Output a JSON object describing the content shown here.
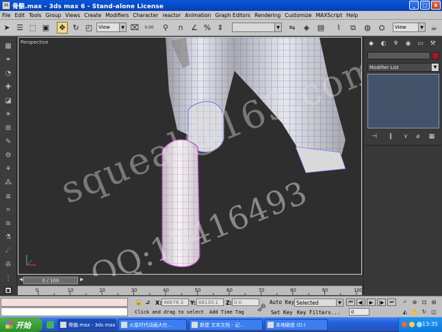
{
  "window": {
    "title": "骨骼.max - 3ds max 6 - Stand-alone License",
    "app_icon": "3ds-max-icon",
    "buttons": {
      "minimize": "_",
      "maximize": "□",
      "close": "x"
    }
  },
  "menubar": {
    "items": [
      "File",
      "Edit",
      "Tools",
      "Group",
      "Views",
      "Create",
      "Modifiers",
      "Character",
      "reactor",
      "Animation",
      "Graph Editors",
      "Rendering",
      "Customize",
      "MAXScript",
      "Help"
    ]
  },
  "toolbar": {
    "icons": [
      "select-arrow-icon",
      "select-by-name-icon",
      "rect-selection-icon",
      "window-crossing-icon",
      "move-icon",
      "rotate-icon",
      "scale-icon",
      "view-combo",
      "pivot-icon",
      "select-manipulate-icon",
      "snap-2d-icon",
      "angle-snap-icon",
      "percent-snap-icon",
      "spinner-snap-icon",
      "named-selection-combo",
      "mirror-icon",
      "align-icon",
      "layer-icon",
      "curve-editor-icon",
      "schematic-icon",
      "material-editor-icon",
      "render-setup-icon",
      "render-view-combo",
      "quick-render-icon"
    ],
    "view_combo": "View",
    "render_combo": "View",
    "named_selection": "",
    "snap_value": "0.00"
  },
  "viewport": {
    "label": "Perspective",
    "watermark_line1": "squeal@163.com",
    "watermark_line2": "QQ:13416493"
  },
  "command_panel": {
    "tabs": [
      "create-icon",
      "modify-icon",
      "hierarchy-icon",
      "motion-icon",
      "display-icon",
      "utilities-icon"
    ],
    "name_field": "",
    "object_color": "#a01828",
    "modifier_list": "Modifier List"
  },
  "time_slider": {
    "position": "0 / 100",
    "current_frame": 0,
    "total_frames": 100
  },
  "trackbar": {
    "ticks": [
      "0",
      "10",
      "20",
      "30",
      "40",
      "50",
      "60",
      "70",
      "80",
      "90",
      "100"
    ]
  },
  "status": {
    "x_label": "X:",
    "x_value": "96678.3",
    "y_label": "Y:",
    "y_value": "68130.1",
    "z_label": "Z:",
    "z_value": "0.0",
    "prompt": "Click and drag to select",
    "add_time_tag": "Add Time Tag",
    "auto_key": "Auto Key",
    "set_key": "Set Key",
    "selected_combo": "Selected",
    "key_filters": "Key Filters...",
    "frame_value": "0"
  },
  "taskbar": {
    "start": "开始",
    "tasks": [
      {
        "label": "骨骼.max - 3ds max ...",
        "active": true
      },
      {
        "label": "火星时代动画大社...",
        "active": false
      },
      {
        "label": "新建 文本文档 - 记...",
        "active": false
      },
      {
        "label": "本地磁盘 (D:)",
        "active": false
      }
    ],
    "clock": "13:35"
  }
}
